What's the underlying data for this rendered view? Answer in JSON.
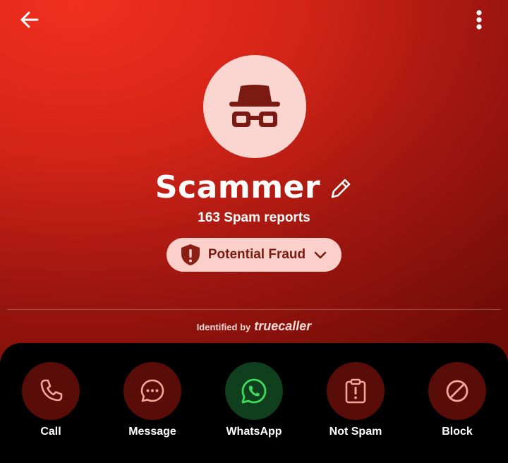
{
  "colors": {
    "hero_accent": "#e02a1b",
    "avatar_bg": "#fbd5d0",
    "spy_icon": "#7a1a12",
    "fraud_pill_bg": "#fbd0ca",
    "fraud_text": "#7a1a12",
    "action_red_bg": "#5a0c08",
    "action_red_icon": "#f4a49a",
    "whatsapp_bg": "#0f3f1c",
    "whatsapp_icon": "#3ddc5f"
  },
  "header": {
    "back_icon": "arrow-left-icon",
    "menu_icon": "more-vertical-icon"
  },
  "profile": {
    "avatar_icon": "incognito-spy-icon",
    "name": "Scammer",
    "edit_icon": "pencil-icon",
    "spam_reports": "163 Spam reports",
    "fraud_label": "Potential Fraud",
    "fraud_icon": "shield-alert-icon",
    "fraud_chevron": "chevron-down-icon"
  },
  "identified": {
    "prefix": "Identified by",
    "brand": "truecaller"
  },
  "actions": [
    {
      "label": "Call",
      "icon": "phone-icon"
    },
    {
      "label": "Message",
      "icon": "message-bubble-icon"
    },
    {
      "label": "WhatsApp",
      "icon": "whatsapp-icon"
    },
    {
      "label": "Not Spam",
      "icon": "clipboard-alert-icon"
    },
    {
      "label": "Block",
      "icon": "block-icon"
    }
  ]
}
